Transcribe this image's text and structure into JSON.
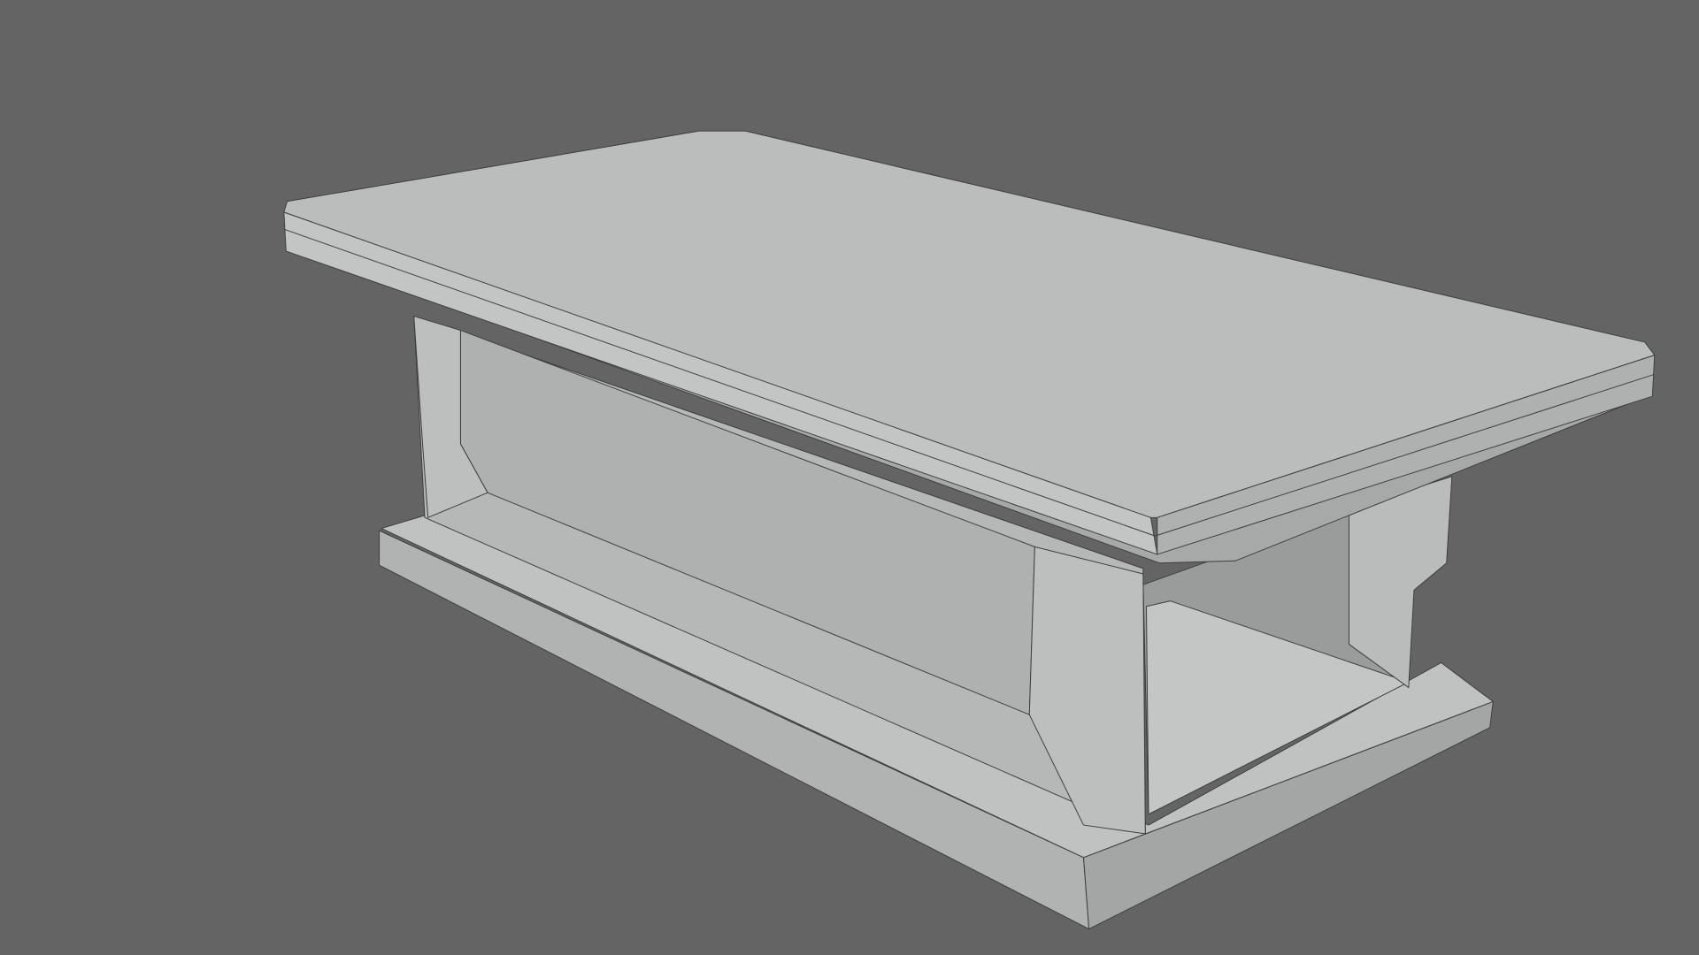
{
  "scene": {
    "subject": "table-3d-wireframe-render",
    "colors": {
      "background": "#646464",
      "top_face": "#babdbb",
      "edge_light": "#c4c7c5",
      "edge_mid": "#a9acaa",
      "panel": "#b3b6b4",
      "shadow": "#8e908f",
      "wire": "#3c3e3d"
    }
  }
}
